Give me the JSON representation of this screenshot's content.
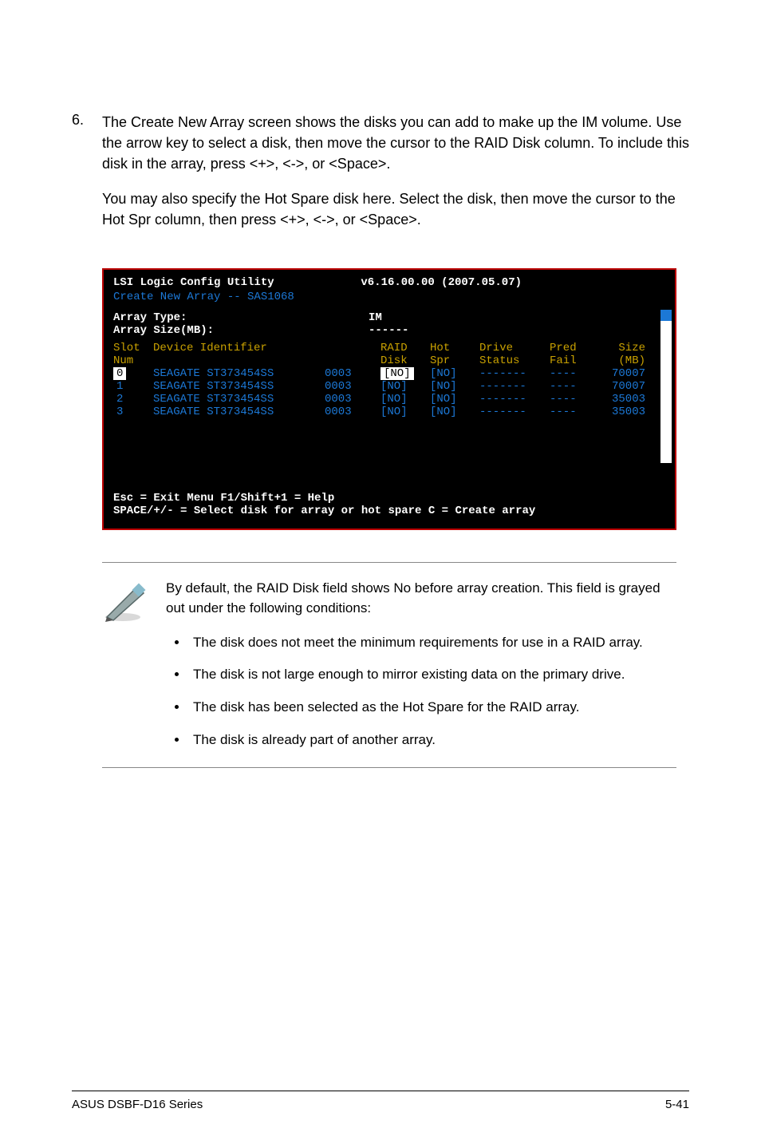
{
  "step": {
    "number": "6.",
    "para1": "The Create New Array screen shows the disks you can add to make up the IM volume. Use the arrow key to select a disk, then move the cursor to the RAID Disk column. To include this disk in the array, press <+>, <->, or <Space>.",
    "para2": "You may also specify the Hot Spare disk here. Select the disk, then move the cursor to the Hot Spr column, then press <+>, <->, or <Space>."
  },
  "terminal": {
    "utility": "LSI Logic Config Utility",
    "version": "v6.16.00.00 (2007.05.07)",
    "subtitle": "Create New Array -- SAS1068",
    "array_type_label": "Array Type:",
    "array_type_value": "IM",
    "array_size_label": "Array Size(MB):",
    "array_size_value": "------",
    "headers": {
      "slot1": "Slot",
      "slot2": "Num",
      "dev": "Device Identifier",
      "raid1": "RAID",
      "raid2": "Disk",
      "hot1": "Hot",
      "hot2": "Spr",
      "drv1": "Drive",
      "drv2": "Status",
      "pred1": "Pred",
      "pred2": "Fail",
      "size1": "Size",
      "size2": "(MB)"
    },
    "rows": [
      {
        "slot": "0",
        "dev": "SEAGATE ST373454SS",
        "rev": "0003",
        "raid": "[NO]",
        "hot": "[NO]",
        "drv": "-------",
        "pred": "----",
        "size": "70007"
      },
      {
        "slot": "1",
        "dev": "SEAGATE ST373454SS",
        "rev": "0003",
        "raid": "[NO]",
        "hot": "[NO]",
        "drv": "-------",
        "pred": "----",
        "size": "70007"
      },
      {
        "slot": "2",
        "dev": "SEAGATE ST373454SS",
        "rev": "0003",
        "raid": "[NO]",
        "hot": "[NO]",
        "drv": "-------",
        "pred": "----",
        "size": "35003"
      },
      {
        "slot": "3",
        "dev": "SEAGATE ST373454SS",
        "rev": "0003",
        "raid": "[NO]",
        "hot": "[NO]",
        "drv": "-------",
        "pred": "----",
        "size": "35003"
      }
    ],
    "help1": "Esc = Exit Menu    F1/Shift+1 = Help",
    "help2": "SPACE/+/- = Select disk for array or hot spare    C = Create array"
  },
  "note": {
    "intro": "By default, the RAID Disk field shows No before array creation. This field is grayed out under the following conditions:",
    "bullets": [
      "The disk does not meet the  minimum requirements for use in a RAID array.",
      "The disk is not large enough to mirror existing data on the primary drive.",
      "The disk has been selected as the Hot Spare for the RAID array.",
      "The disk is already part of another array."
    ]
  },
  "footer": {
    "left": "ASUS DSBF-D16 Series",
    "right": "5-41"
  }
}
